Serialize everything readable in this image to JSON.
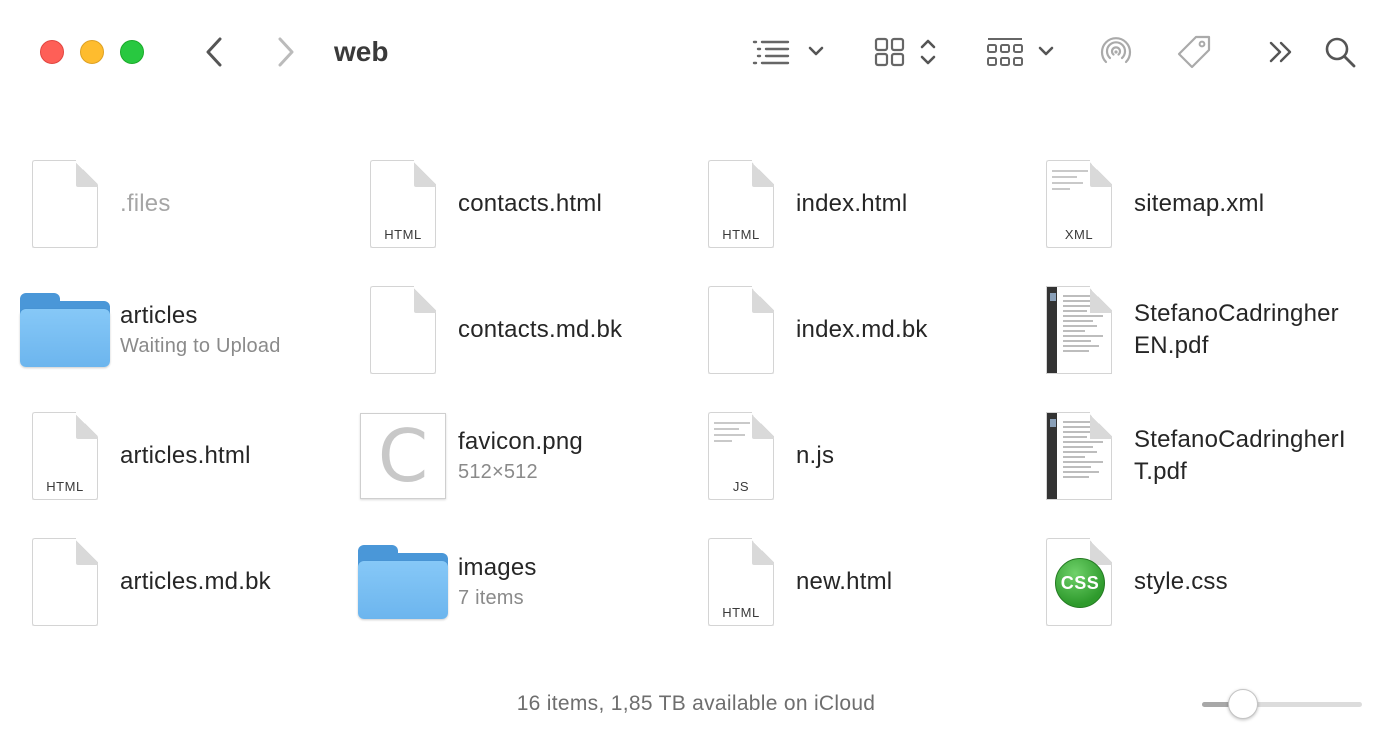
{
  "window": {
    "title": "web"
  },
  "toolbar": {
    "traffic_lights": {
      "close": "#fe5f57",
      "minimize": "#febc2e",
      "zoom": "#28c840"
    },
    "icons": [
      "back-icon",
      "forward-icon",
      "list-view-icon",
      "icon-view-icon",
      "group-icon",
      "airdrop-icon",
      "tag-icon",
      "more-icon",
      "search-icon"
    ]
  },
  "files": [
    {
      "name": ".files",
      "sub": "",
      "kind": "doc",
      "label": "",
      "dim": true
    },
    {
      "name": "contacts.html",
      "sub": "",
      "kind": "doc",
      "label": "HTML"
    },
    {
      "name": "index.html",
      "sub": "",
      "kind": "doc",
      "label": "HTML"
    },
    {
      "name": "sitemap.xml",
      "sub": "",
      "kind": "doc",
      "label": "XML"
    },
    {
      "name": "articles",
      "sub": "Waiting to Upload",
      "kind": "folder"
    },
    {
      "name": "contacts.md.bk",
      "sub": "",
      "kind": "doc",
      "label": ""
    },
    {
      "name": "index.md.bk",
      "sub": "",
      "kind": "doc",
      "label": ""
    },
    {
      "name": "StefanoCadringherEN.pdf",
      "sub": "",
      "kind": "pdf"
    },
    {
      "name": "articles.html",
      "sub": "",
      "kind": "doc",
      "label": "HTML"
    },
    {
      "name": "favicon.png",
      "sub": "512×512",
      "kind": "image",
      "glyph": "C"
    },
    {
      "name": "n.js",
      "sub": "",
      "kind": "doc",
      "label": "JS"
    },
    {
      "name": "StefanoCadringherIT.pdf",
      "sub": "",
      "kind": "pdf"
    },
    {
      "name": "articles.md.bk",
      "sub": "",
      "kind": "doc",
      "label": ""
    },
    {
      "name": "images",
      "sub": "7 items",
      "kind": "folder"
    },
    {
      "name": "new.html",
      "sub": "",
      "kind": "doc",
      "label": "HTML"
    },
    {
      "name": "style.css",
      "sub": "",
      "kind": "css",
      "badge": "CSS"
    }
  ],
  "status": {
    "text": "16 items, 1,85 TB available on iCloud"
  },
  "icon_size_slider": {
    "level": 0.2
  }
}
